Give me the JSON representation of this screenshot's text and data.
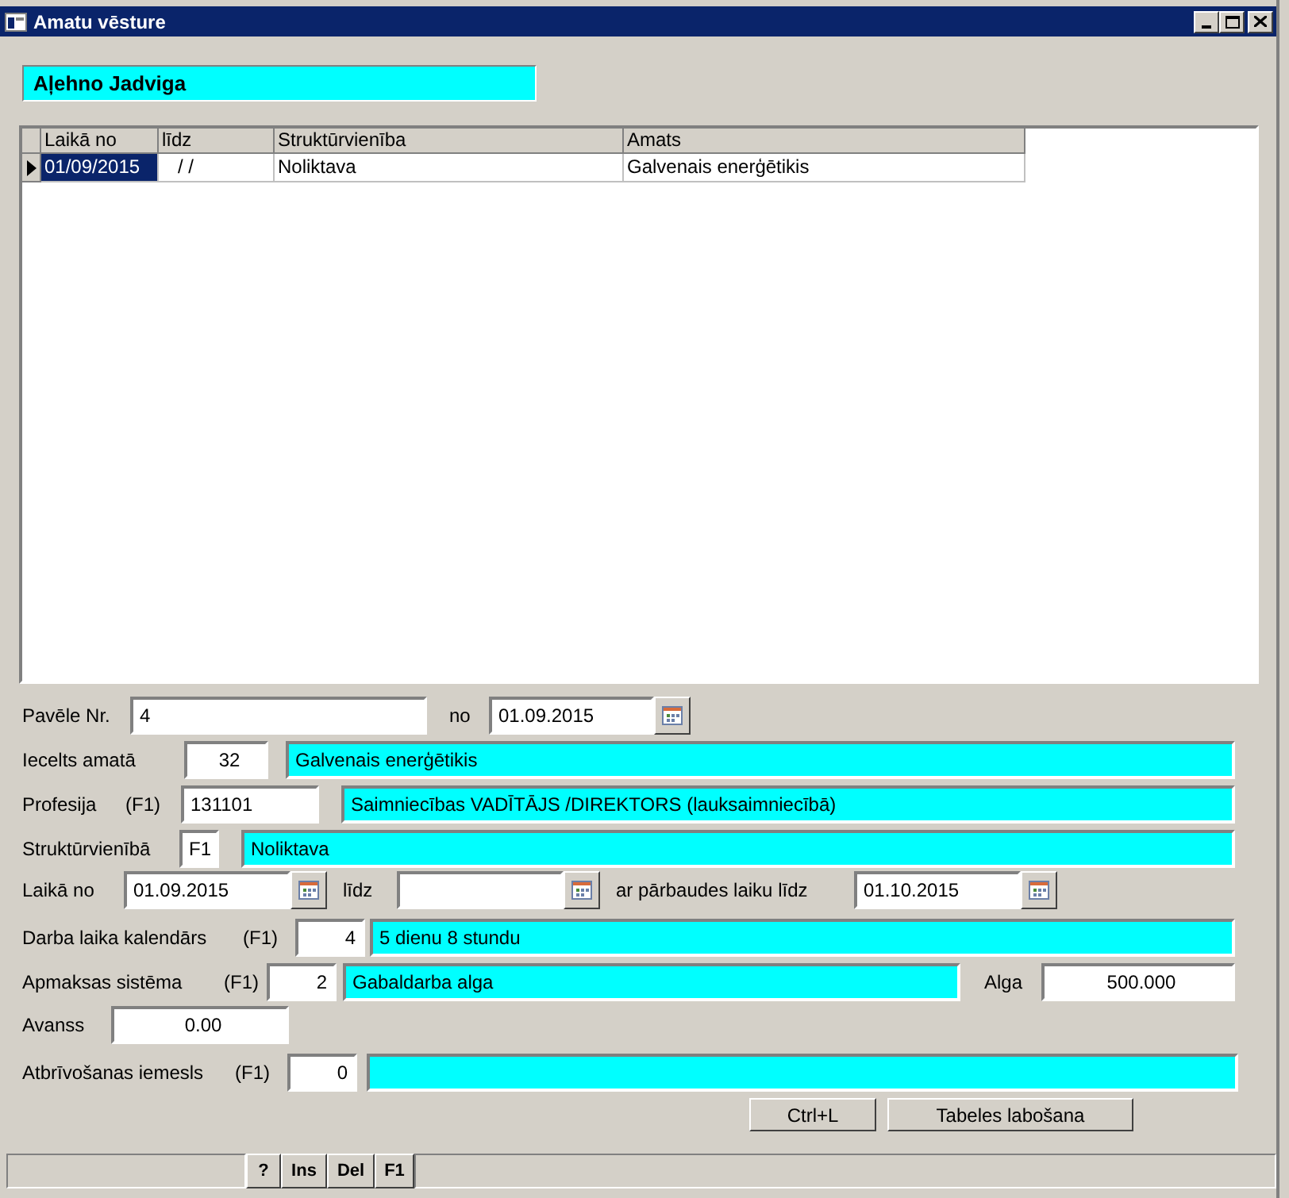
{
  "window": {
    "title": "Amatu vēsture"
  },
  "employee_name": "Aļehno Jadviga",
  "table": {
    "columns": [
      "Laikā no",
      "līdz",
      "Struktūrvienība",
      "Amats"
    ],
    "rows": [
      {
        "selected": true,
        "cells": [
          "01/09/2015",
          "/ /",
          "Noliktava",
          "Galvenais enerģētikis"
        ]
      }
    ]
  },
  "form_rows": [
    {
      "items": [
        {
          "kind": "label",
          "text": "Pavēle Nr."
        },
        {
          "kind": "input",
          "value": "4"
        },
        {
          "kind": "label",
          "text": "no"
        },
        {
          "kind": "input",
          "value": "01.09.2015"
        },
        {
          "kind": "calendar"
        }
      ]
    },
    {
      "items": [
        {
          "kind": "label",
          "text": "Iecelts amatā"
        },
        {
          "kind": "input",
          "value": "32"
        },
        {
          "kind": "lookup",
          "value": "Galvenais enerģētikis"
        }
      ]
    },
    {
      "items": [
        {
          "kind": "label",
          "text": "Profesija"
        },
        {
          "kind": "label",
          "text": "(F1)"
        },
        {
          "kind": "input",
          "value": "131101"
        },
        {
          "kind": "lookup",
          "value": "Saimniecības VADĪTĀJS /DIREKTORS (lauksaimniecībā)"
        }
      ]
    },
    {
      "items": [
        {
          "kind": "label",
          "text": "Struktūrvienībā"
        },
        {
          "kind": "input",
          "value": "F1"
        },
        {
          "kind": "lookup",
          "value": "Noliktava"
        }
      ]
    },
    {
      "items": [
        {
          "kind": "label",
          "text": "Laikā no"
        },
        {
          "kind": "input",
          "value": "01.09.2015"
        },
        {
          "kind": "calendar"
        },
        {
          "kind": "label",
          "text": "līdz"
        },
        {
          "kind": "input"
        },
        {
          "kind": "calendar"
        },
        {
          "kind": "label",
          "text": "ar pārbaudes laiku līdz"
        },
        {
          "kind": "input",
          "value": "01.10.2015"
        },
        {
          "kind": "calendar"
        }
      ]
    },
    {
      "items": [
        {
          "kind": "label",
          "text": "Darba laika kalendārs"
        },
        {
          "kind": "label",
          "text": "(F1)"
        },
        {
          "kind": "input",
          "value": "4"
        },
        {
          "kind": "lookup",
          "value": "5 dienu 8 stundu"
        }
      ]
    },
    {
      "items": [
        {
          "kind": "label",
          "text": "Apmaksas sistēma"
        },
        {
          "kind": "label",
          "text": "(F1)"
        },
        {
          "kind": "input",
          "value": "2"
        },
        {
          "kind": "lookup",
          "value": "Gabaldarba alga"
        },
        {
          "kind": "label",
          "text": "Alga"
        },
        {
          "kind": "input",
          "value": "500.000"
        }
      ]
    },
    {
      "items": [
        {
          "kind": "label",
          "text": "Avanss"
        },
        {
          "kind": "input",
          "value": "0.00"
        }
      ]
    },
    {
      "items": [
        {
          "kind": "label",
          "text": "Atbrīvošanas iemesls"
        },
        {
          "kind": "label",
          "text": "(F1)"
        },
        {
          "kind": "input",
          "value": "0"
        },
        {
          "kind": "lookup"
        }
      ]
    }
  ],
  "buttons": [
    "Ctrl+L",
    "Tabeles labošana"
  ],
  "status_bar": {
    "keys": [
      "?",
      "Ins",
      "Del",
      "F1"
    ]
  }
}
